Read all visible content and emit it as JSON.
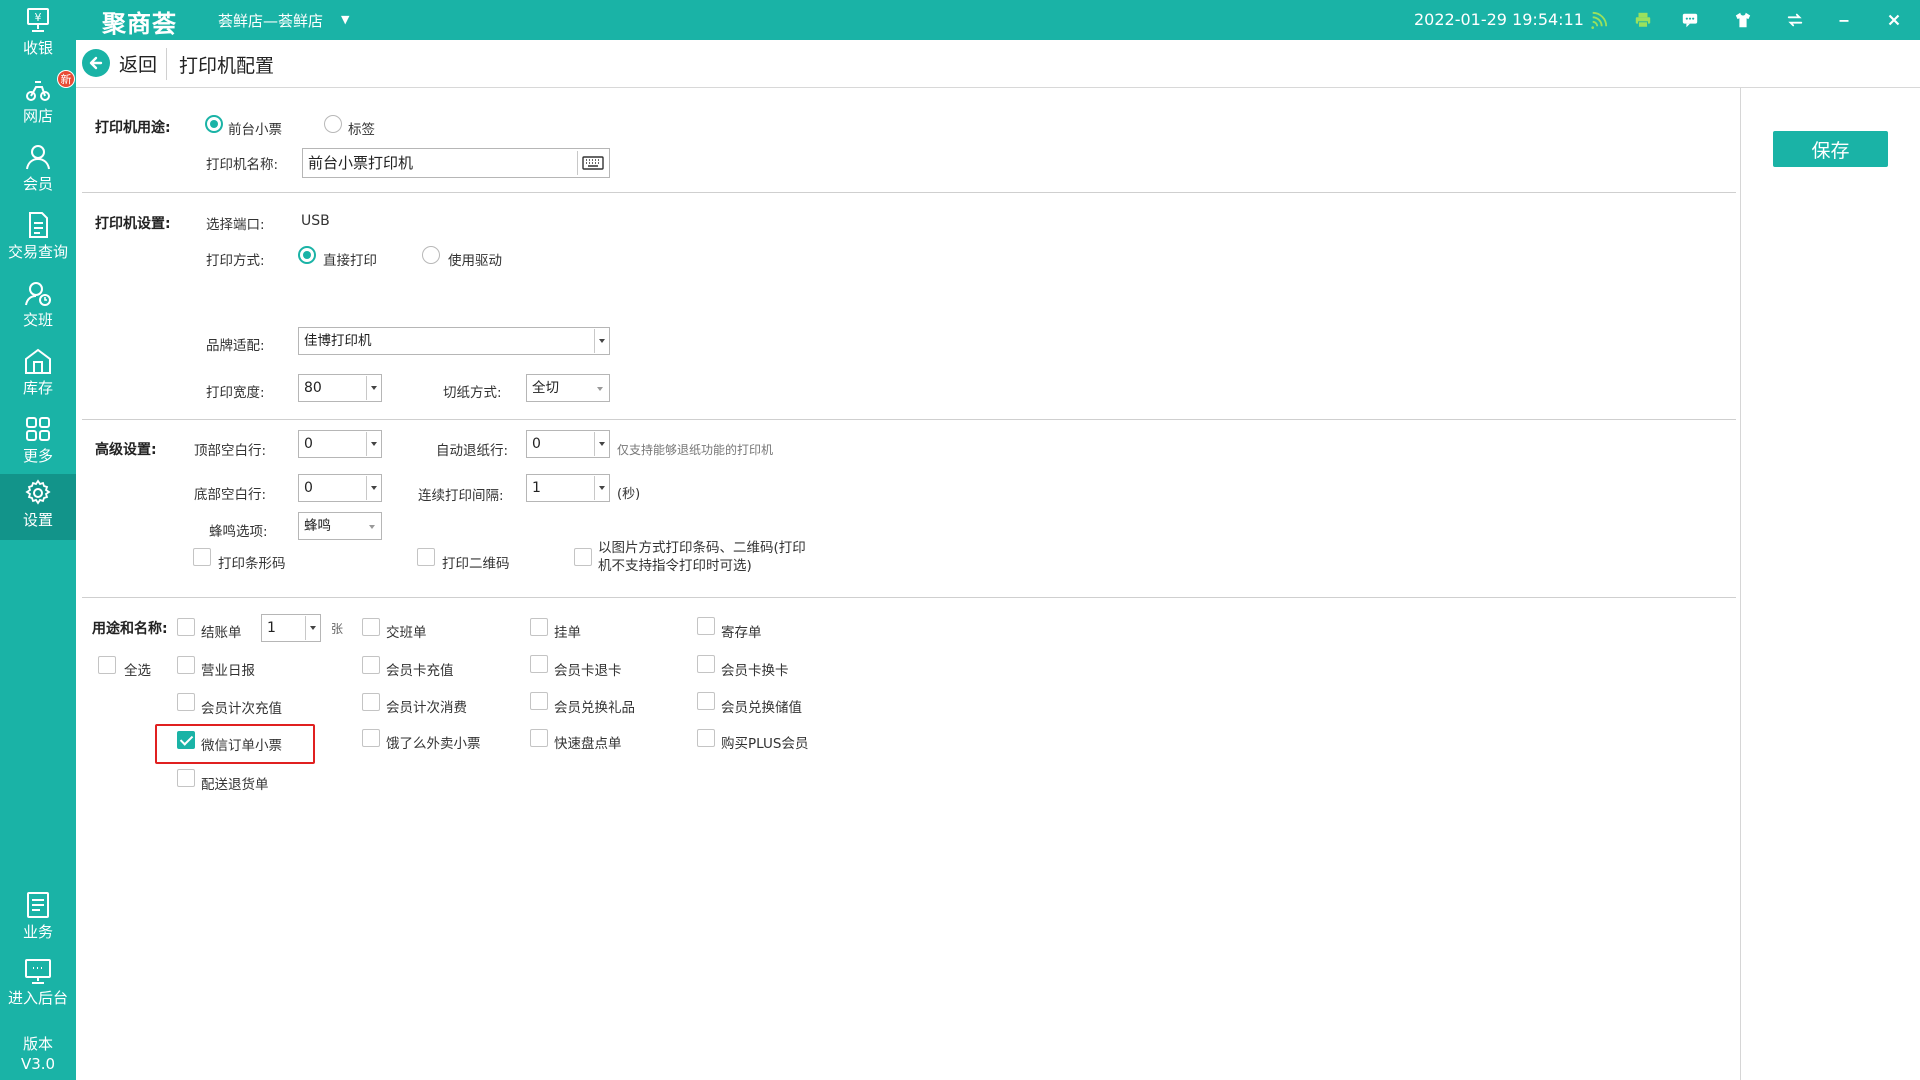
{
  "topbar": {
    "logo": "聚商荟",
    "store": "荟鲜店—荟鲜店",
    "datetime": "2022-01-29 19:54:11",
    "icons": [
      "wifi-icon",
      "printer-icon",
      "message-icon",
      "shirt-icon",
      "switch-icon",
      "minimize-icon",
      "close-icon"
    ]
  },
  "sidebar": {
    "items": [
      {
        "label": "收银",
        "icon": "cashier-icon"
      },
      {
        "label": "网店",
        "icon": "online-store-icon",
        "badge": "新"
      },
      {
        "label": "会员",
        "icon": "member-icon"
      },
      {
        "label": "交易查询",
        "icon": "transaction-query-icon"
      },
      {
        "label": "交班",
        "icon": "shift-handover-icon"
      },
      {
        "label": "库存",
        "icon": "inventory-icon"
      },
      {
        "label": "更多",
        "icon": "more-grid-icon"
      },
      {
        "label": "设置",
        "icon": "settings-gear-icon",
        "active": true
      },
      {
        "label": "业务",
        "icon": "business-icon"
      },
      {
        "label": "进入后台",
        "icon": "backend-monitor-icon"
      }
    ],
    "version_label": "版本",
    "version": "V3.0"
  },
  "header": {
    "back_label": "返回",
    "title": "打印机配置"
  },
  "save_label": "保存",
  "usage": {
    "section_label": "打印机用途:",
    "options": [
      "前台小票",
      "标签"
    ],
    "selected": "前台小票",
    "name_label": "打印机名称:",
    "name_value": "前台小票打印机"
  },
  "printer_settings": {
    "section_label": "打印机设置:",
    "port_label": "选择端口:",
    "port_value": "USB",
    "mode_label": "打印方式:",
    "mode_options": [
      "直接打印",
      "使用驱动"
    ],
    "mode_selected": "直接打印",
    "brand_label": "品牌适配:",
    "brand_value": "佳博打印机",
    "width_label": "打印宽度:",
    "width_value": "80",
    "cut_label": "切纸方式:",
    "cut_value": "全切"
  },
  "advanced": {
    "section_label": "高级设置:",
    "top_blank_label": "顶部空白行:",
    "top_blank_value": "0",
    "auto_retract_label": "自动退纸行:",
    "auto_retract_value": "0",
    "auto_retract_note": "仅支持能够退纸功能的打印机",
    "bottom_blank_label": "底部空白行:",
    "bottom_blank_value": "0",
    "interval_label": "连续打印间隔:",
    "interval_value": "1",
    "interval_unit": "(秒)",
    "beep_label": "蜂鸣选项:",
    "beep_value": "蜂鸣",
    "print_barcode": "打印条形码",
    "print_qrcode": "打印二维码",
    "image_mode_line1": "以图片方式打印条码、二维码(打印",
    "image_mode_line2": "机不支持指令打印时可选)"
  },
  "usage_names": {
    "section_label": "用途和名称:",
    "select_all": "全选",
    "copies_value": "1",
    "copies_unit": "张",
    "items": {
      "checkout": "结账单",
      "shift": "交班单",
      "hold": "挂单",
      "deposit": "寄存单",
      "daily_report": "营业日报",
      "card_recharge": "会员卡充值",
      "card_refund": "会员卡退卡",
      "card_replace": "会员卡换卡",
      "times_recharge": "会员计次充值",
      "times_consume": "会员计次消费",
      "gift_redeem": "会员兑换礼品",
      "value_redeem": "会员兑换储值",
      "wechat_receipt": "微信订单小票",
      "eleme_receipt": "饿了么外卖小票",
      "stocktake": "快速盘点单",
      "plus_member": "购买PLUS会员",
      "delivery_return": "配送退货单"
    },
    "checked": [
      "微信订单小票"
    ]
  },
  "colors": {
    "accent": "#1ab3a6",
    "highlight_box": "#e02020"
  }
}
